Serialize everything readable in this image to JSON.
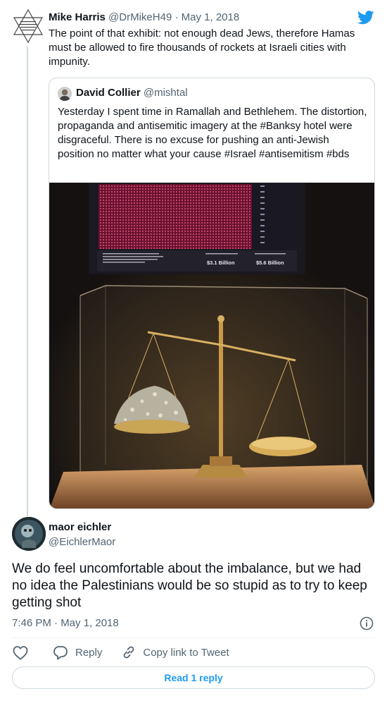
{
  "parent_tweet": {
    "avatar_icon": "star-of-david-icon",
    "author_name": "Mike Harris",
    "author_handle": "@DrMikeH49",
    "separator": "·",
    "date": "May 1, 2018",
    "text": "The point of that exhibit: not enough dead Jews, therefore Hamas must be allowed to fire thousands of rockets at Israeli cities with impunity."
  },
  "quoted_tweet": {
    "author_name": "David Collier",
    "author_handle": "@mishtal",
    "text": "Yesterday I spent time in Ramallah and Bethlehem. The distortion, propaganda and  antisemitic imagery at the #Banksy hotel  were disgraceful.  There is no excuse for pushing an anti-Jewish position no matter what your cause #Israel #antisemitism #bds",
    "photo": {
      "caption_left": "This was the 13th major assault on Gaza since 2000. Intermittent smaller assaults continued during this period, including drone strikes, land and navy shelling and aerial bombardment.",
      "stat_1_label": "20% US military aid to Israel",
      "stat_1_value": "$3.1 Billion",
      "stat_2_label": "20% Israeli arms sales",
      "stat_2_value": "$5.6 Billion"
    }
  },
  "reply_tweet": {
    "author_name": "maor eichler",
    "author_handle": "@EichlerMaor",
    "text": "We do feel uncomfortable about the imbalance, but we had no idea the Palestinians would be so stupid as to try to keep getting shot",
    "timestamp": "7:46 PM · May 1, 2018"
  },
  "actions": {
    "reply_label": "Reply",
    "copy_link_label": "Copy link to Tweet"
  },
  "read_replies_label": "Read 1 reply",
  "colors": {
    "accent": "#1d9bf0",
    "secondary_text": "#536471",
    "border": "#cfd9de"
  }
}
